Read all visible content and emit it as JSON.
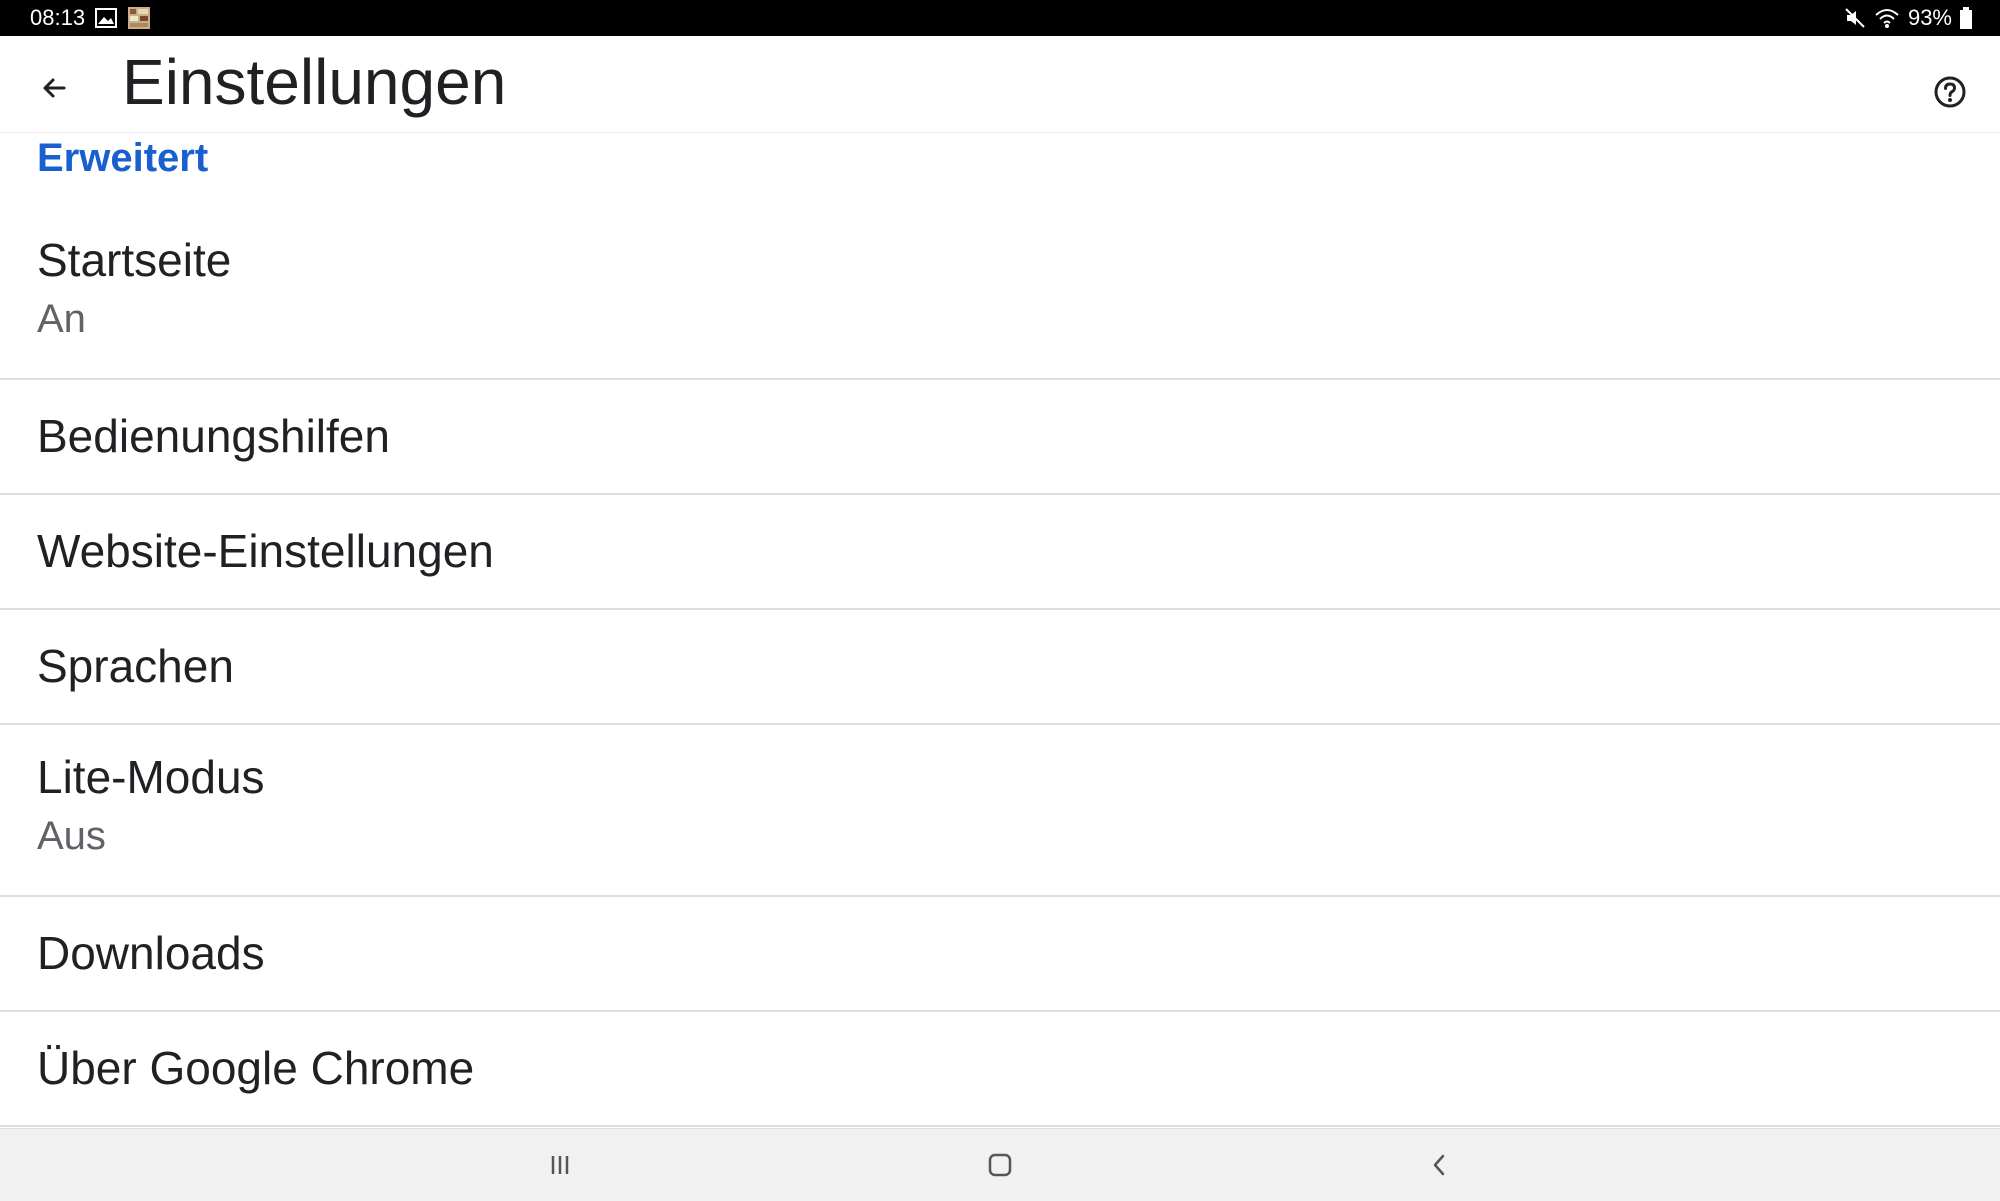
{
  "status_bar": {
    "time": "08:13",
    "battery": "93%",
    "icons": [
      "gallery-icon",
      "app-notification-icon",
      "mute-icon",
      "wifi-icon",
      "battery-icon"
    ]
  },
  "app_bar": {
    "title": "Einstellungen",
    "back_icon": "arrow-back-icon",
    "help_icon": "help-circle-icon"
  },
  "section": {
    "header": "Erweitert",
    "accent_color": "#1a5fd0"
  },
  "settings": [
    {
      "title": "Startseite",
      "summary": "An"
    },
    {
      "title": "Bedienungshilfen",
      "summary": ""
    },
    {
      "title": "Website-Einstellungen",
      "summary": ""
    },
    {
      "title": "Sprachen",
      "summary": ""
    },
    {
      "title": "Lite-Modus",
      "summary": "Aus"
    },
    {
      "title": "Downloads",
      "summary": ""
    },
    {
      "title": "Über Google Chrome",
      "summary": ""
    }
  ],
  "nav_bar": {
    "icons": [
      "recent-apps-icon",
      "home-icon",
      "back-nav-icon"
    ]
  }
}
